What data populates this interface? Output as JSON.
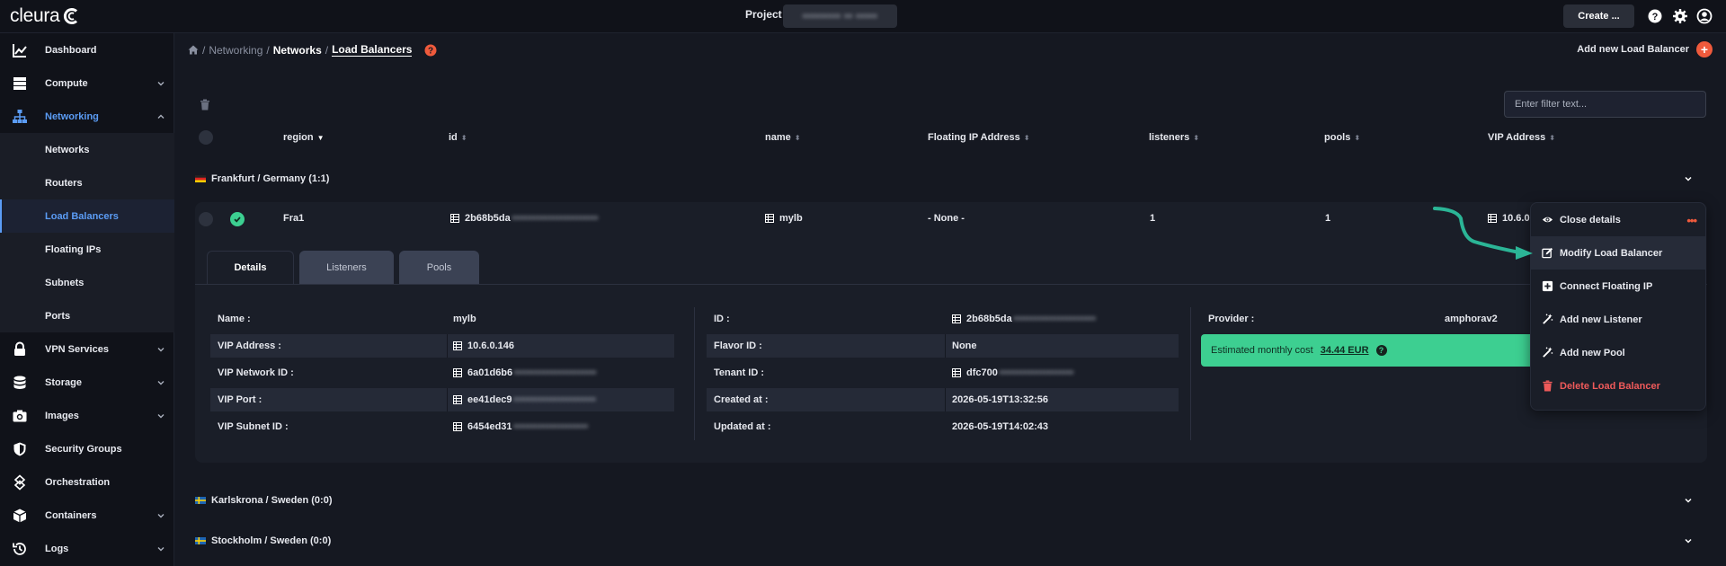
{
  "topbar": {
    "brand": "cleura",
    "project_label": "Project",
    "project_value": "••••••••• •• •••••",
    "create_label": "Create ..."
  },
  "sidebar": {
    "items": [
      {
        "label": "Dashboard"
      },
      {
        "label": "Compute"
      },
      {
        "label": "Networking"
      },
      {
        "label": "Networks"
      },
      {
        "label": "Routers"
      },
      {
        "label": "Load Balancers"
      },
      {
        "label": "Floating IPs"
      },
      {
        "label": "Subnets"
      },
      {
        "label": "Ports"
      },
      {
        "label": "VPN Services"
      },
      {
        "label": "Storage"
      },
      {
        "label": "Images"
      },
      {
        "label": "Security Groups"
      },
      {
        "label": "Orchestration"
      },
      {
        "label": "Containers"
      },
      {
        "label": "Logs"
      }
    ]
  },
  "breadcrumb": {
    "sep": "/",
    "networking": "Networking",
    "networks": "Networks",
    "current": "Load Balancers"
  },
  "actions": {
    "add_new": "Add new Load Balancer"
  },
  "filter": {
    "placeholder": "Enter filter text..."
  },
  "table": {
    "headers": {
      "region": "region",
      "id": "id",
      "name": "name",
      "floating": "Floating IP Address",
      "listeners": "listeners",
      "pools": "pools",
      "vip": "VIP Address"
    },
    "groups": [
      {
        "label": "Frankfurt / Germany (1:1)"
      },
      {
        "label": "Karlskrona / Sweden (0:0)"
      },
      {
        "label": "Stockholm / Sweden (0:0)"
      }
    ],
    "row": {
      "region": "Fra1",
      "id": "2b68b5da",
      "id_blur": "••••••••••••••••••••••",
      "name": "mylb",
      "floating": "- None -",
      "listeners": "1",
      "pools": "1",
      "vip": "10.6.0."
    }
  },
  "tabs": [
    "Details",
    "Listeners",
    "Pools"
  ],
  "details": {
    "left": [
      {
        "label": "Name :",
        "value": "mylb",
        "blur": ""
      },
      {
        "label": "VIP Address :",
        "value": "10.6.0.146",
        "blur": ""
      },
      {
        "label": "VIP Network ID :",
        "value": "6a01d6b6",
        "blur": "•••••••••••••••••••••"
      },
      {
        "label": "VIP Port :",
        "value": "ee41dec9",
        "blur": "•••••••••••••••••••••"
      },
      {
        "label": "VIP Subnet ID :",
        "value": "6454ed31",
        "blur": "•••••••••••••••••••"
      }
    ],
    "middle": [
      {
        "label": "ID :",
        "value": "2b68b5da",
        "blur": "•••••••••••••••••••••"
      },
      {
        "label": "Flavor ID :",
        "value": "None",
        "blur": ""
      },
      {
        "label": "Tenant ID :",
        "value": "dfc700",
        "blur": "•••••••••••••••••••"
      },
      {
        "label": "Created at :",
        "value": "2026-05-19T13:32:56",
        "blur": ""
      },
      {
        "label": "Updated at :",
        "value": "2026-05-19T14:02:43",
        "blur": ""
      }
    ],
    "provider_label": "Provider :",
    "provider_value": "amphorav2",
    "cost_label": "Estimated monthly cost",
    "cost_value": "34.44 EUR"
  },
  "menu": {
    "items": [
      {
        "label": "Close details"
      },
      {
        "label": "Modify Load Balancer"
      },
      {
        "label": "Connect Floating IP"
      },
      {
        "label": "Add new Listener"
      },
      {
        "label": "Add new Pool"
      },
      {
        "label": "Delete Load Balancer"
      }
    ],
    "dots": "•••"
  },
  "colors": {
    "accent": "#5b9cf5",
    "success": "#3dcf91",
    "danger": "#ef5a5a",
    "orange": "#ef5a3c",
    "arrow": "#2bb596"
  }
}
